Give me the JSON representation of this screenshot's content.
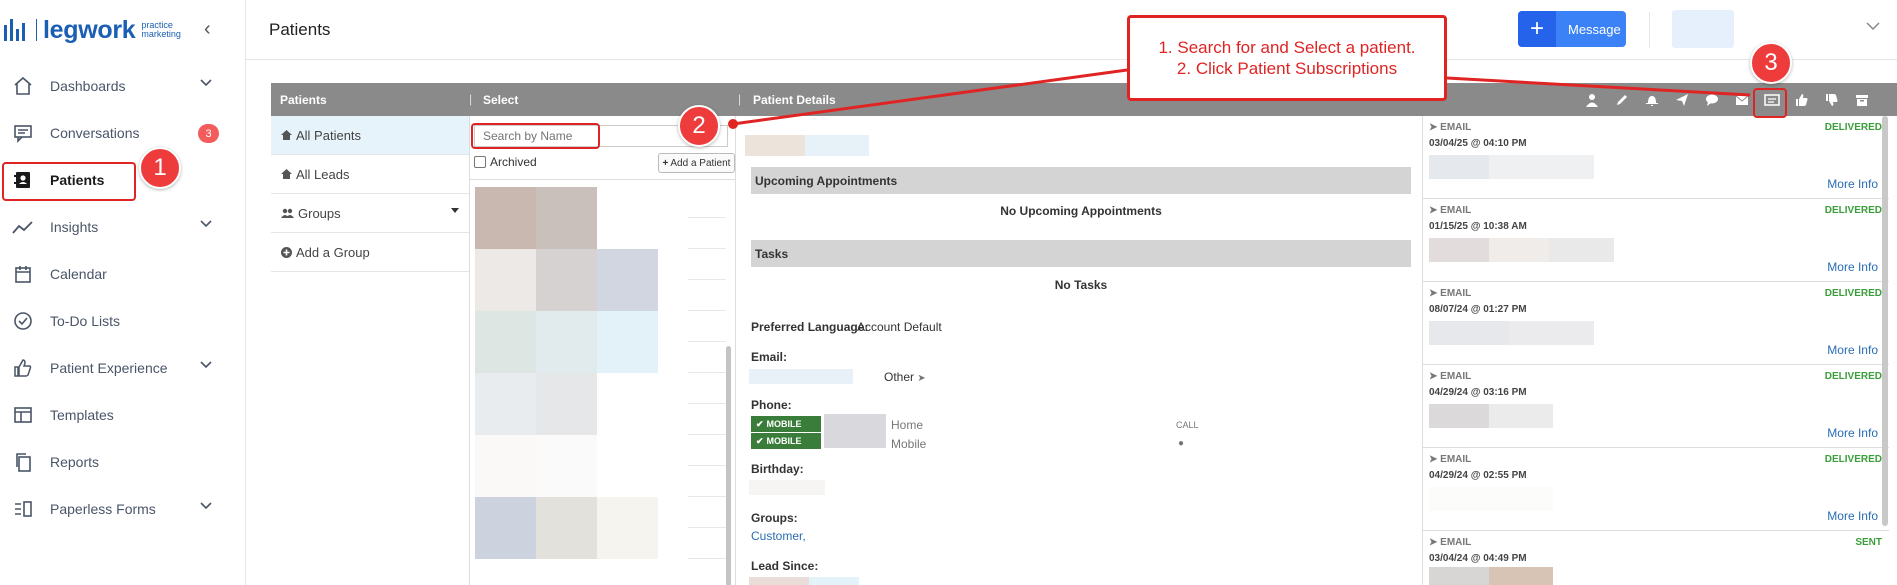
{
  "app": {
    "logo_word": "legwork",
    "logo_sub_line1": "practice",
    "logo_sub_line2": "marketing",
    "collapse_glyph": "‹"
  },
  "sidebar": {
    "items": [
      {
        "label": "Dashboards",
        "icon": "home-icon",
        "has_chevron": true
      },
      {
        "label": "Conversations",
        "icon": "chat-icon",
        "badge": "3"
      },
      {
        "label": "Patients",
        "icon": "contact-card-icon",
        "active": true
      },
      {
        "label": "Insights",
        "icon": "trend-line-icon",
        "has_chevron": true
      },
      {
        "label": "Calendar",
        "icon": "calendar-icon"
      },
      {
        "label": "To-Do Lists",
        "icon": "check-circle-icon"
      },
      {
        "label": "Patient Experience",
        "icon": "thumbs-up-icon",
        "has_chevron": true
      },
      {
        "label": "Templates",
        "icon": "template-icon"
      },
      {
        "label": "Reports",
        "icon": "copy-icon"
      },
      {
        "label": "Paperless Forms",
        "icon": "form-list-icon",
        "has_chevron": true
      }
    ]
  },
  "header": {
    "title": "Patients",
    "message_button": "Message",
    "message_plus": "+"
  },
  "panel": {
    "col_patients": "Patients",
    "col_select": "Select",
    "col_details": "Patient Details",
    "pipe": "|",
    "toolbar_icons": [
      "user-icon",
      "pencil-icon",
      "bell-icon",
      "send-icon",
      "comment-icon",
      "envelope-icon",
      "subscriptions-icon",
      "thumbs-up-icon",
      "thumbs-down-icon",
      "archive-icon"
    ]
  },
  "filters": [
    {
      "label": "All Patients",
      "icon": "home-icon",
      "selected": true
    },
    {
      "label": "All Leads",
      "icon": "home-icon"
    },
    {
      "label": "Groups",
      "icon": "users-icon",
      "has_caret": true
    },
    {
      "label": "Add a Group",
      "icon": "plus-circle-icon"
    }
  ],
  "select": {
    "search_placeholder": "Search by Name",
    "archived_label": "Archived",
    "add_patient_label": "Add a Patient"
  },
  "details": {
    "upcoming_heading": "Upcoming Appointments",
    "no_appointments": "No Upcoming Appointments",
    "tasks_heading": "Tasks",
    "no_tasks": "No Tasks",
    "preferred_language_label": "Preferred Language:",
    "preferred_language_value": "Account Default",
    "email_label": "Email:",
    "email_type": "Other",
    "phone_label": "Phone:",
    "mobile_tag": "MOBILE",
    "phone_home": "Home",
    "phone_mobile": "Mobile",
    "call_label": "CALL",
    "birthday_label": "Birthday:",
    "groups_label": "Groups:",
    "groups_value": "Customer,",
    "lead_since_label": "Lead Since:"
  },
  "communications": [
    {
      "type": "EMAIL",
      "status": "DELIVERED",
      "date": "03/04/25 @ 04:10 PM",
      "more": "More Info"
    },
    {
      "type": "EMAIL",
      "status": "DELIVERED",
      "date": "01/15/25 @ 10:38 AM",
      "more": "More Info"
    },
    {
      "type": "EMAIL",
      "status": "DELIVERED",
      "date": "08/07/24 @ 01:27 PM",
      "more": "More Info"
    },
    {
      "type": "EMAIL",
      "status": "DELIVERED",
      "date": "04/29/24 @ 03:16 PM",
      "more": "More Info"
    },
    {
      "type": "EMAIL",
      "status": "DELIVERED",
      "date": "04/29/24 @ 02:55 PM",
      "more": "More Info"
    },
    {
      "type": "EMAIL",
      "status": "SENT",
      "date": "03/04/24 @ 04:49 PM",
      "more": ""
    }
  ],
  "annotations": {
    "callout_line1": "1. Search for and Select a patient.",
    "callout_line2": "2. Click Patient Subscriptions",
    "marker1": "1",
    "marker2": "2",
    "marker3": "3",
    "annotation_color": "#e02424"
  },
  "colors": {
    "brand": "#1a5fb4",
    "message_button": "#3b82f6",
    "panel_header": "#8a8a8a",
    "delivered": "#3b9e3b",
    "mobile_tag": "#3a7d3a",
    "badge": "#f25c5c"
  }
}
